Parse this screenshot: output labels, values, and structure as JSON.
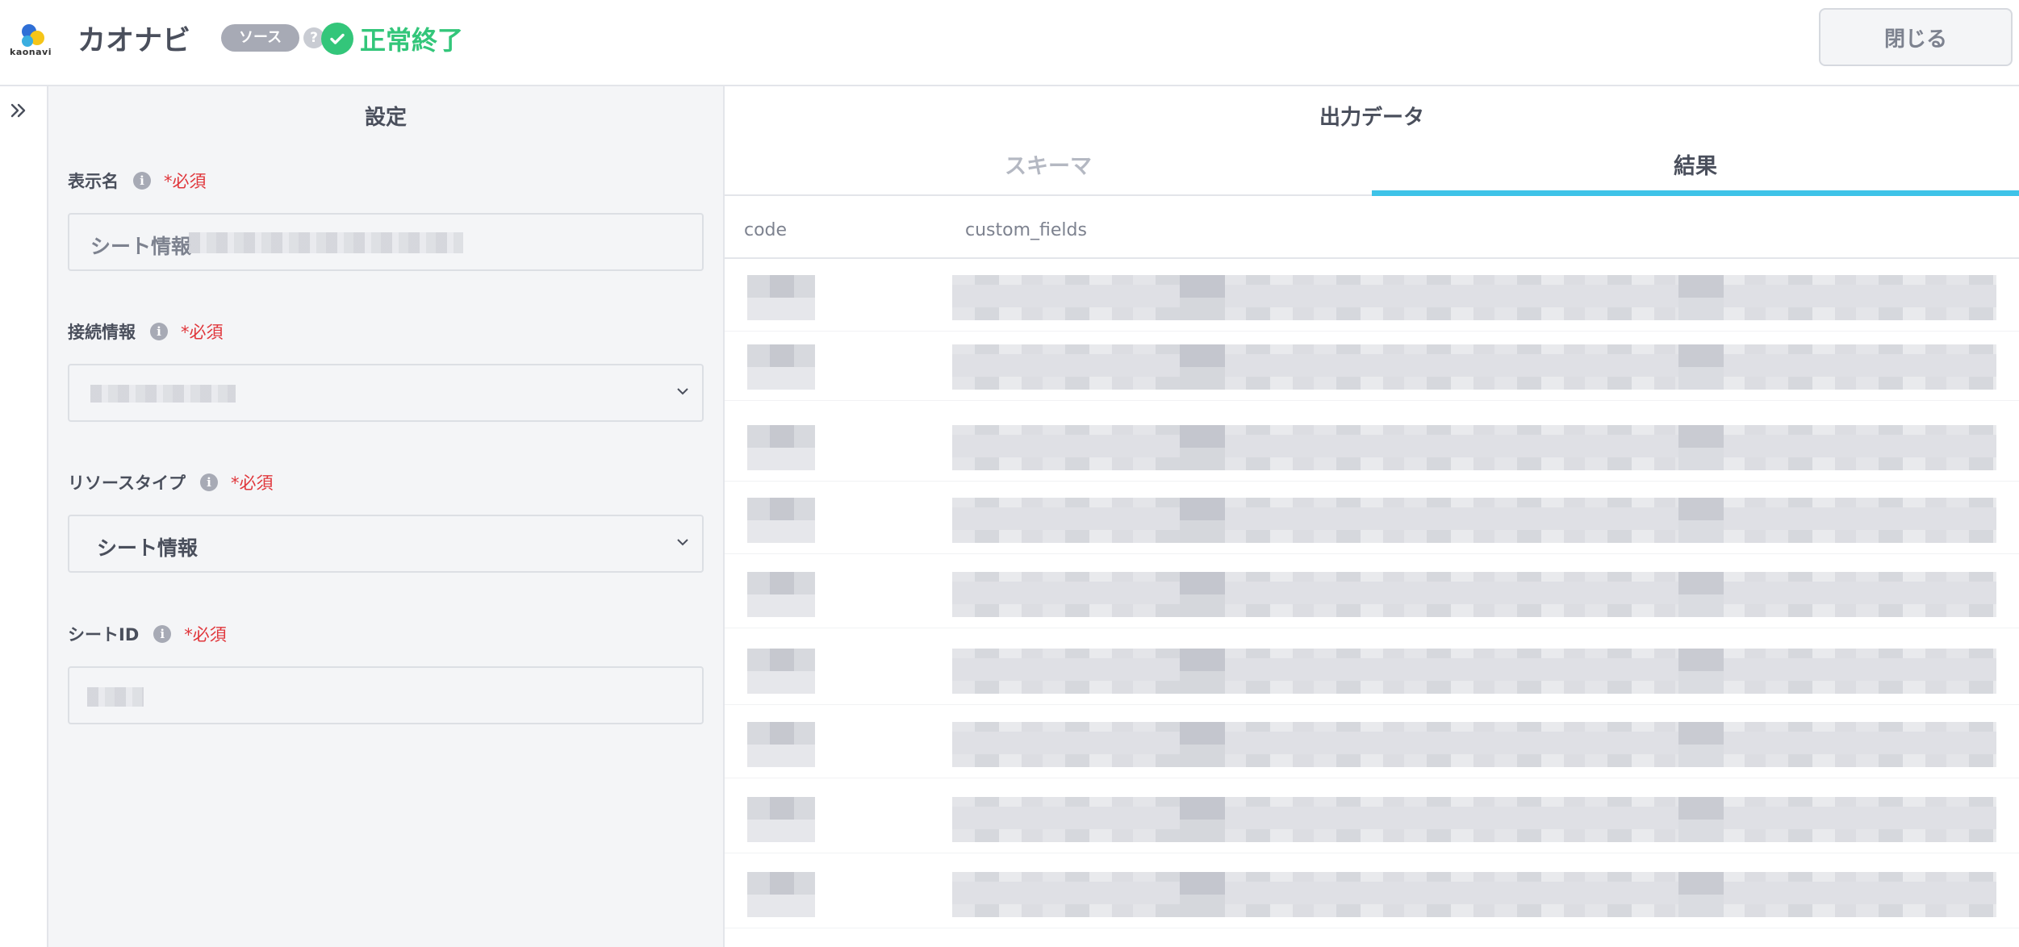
{
  "header": {
    "logo_text": "kaonavi",
    "title": "カオナビ",
    "source_badge": "ソース",
    "help": "?",
    "status": "正常終了",
    "close_label": "閉じる"
  },
  "settings": {
    "title": "設定",
    "required_mark": "*必須",
    "fields": [
      {
        "label": "表示名",
        "value": "シート情報"
      },
      {
        "label": "接続情報",
        "value": ""
      },
      {
        "label": "リソースタイプ",
        "value": "シート情報"
      },
      {
        "label": "シートID",
        "value": ""
      }
    ]
  },
  "output": {
    "title": "出力データ",
    "tabs": [
      {
        "label": "スキーマ",
        "active": false
      },
      {
        "label": "結果",
        "active": true
      }
    ],
    "columns": [
      "code",
      "custom_fields"
    ]
  },
  "colors": {
    "accent_tab": "#3ec3e8",
    "status_green": "#33c67a",
    "required_red": "#e0363b"
  }
}
